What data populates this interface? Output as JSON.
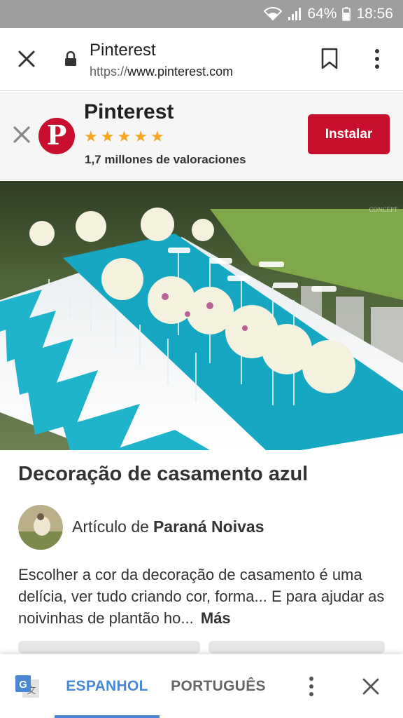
{
  "status_bar": {
    "battery": "64%",
    "time": "18:56"
  },
  "browser": {
    "page_title": "Pinterest",
    "url_scheme": "https://",
    "url_host": "www.pinterest.com"
  },
  "app_banner": {
    "app_name": "Pinterest",
    "stars": 5,
    "ratings_text": "1,7 millones de valoraciones",
    "install_label": "Instalar",
    "brand_color": "#c8102e",
    "star_color": "#f5a623"
  },
  "pin": {
    "image_alt": "",
    "watermark": "CONCEPT",
    "title": "Decoração de casamento azul",
    "author_prefix": "Artículo de",
    "author_name": "Paraná Noivas",
    "description": "Escolher a cor da decoração de casamento é uma delícia, ver tudo criando cor, forma... E para ajudar as noivinhas de plantão ho...",
    "more_label": "Más"
  },
  "translate_bar": {
    "tab_source": "ESPANHOL",
    "tab_target": "PORTUGUÊS",
    "active_color": "#4a88d6"
  }
}
